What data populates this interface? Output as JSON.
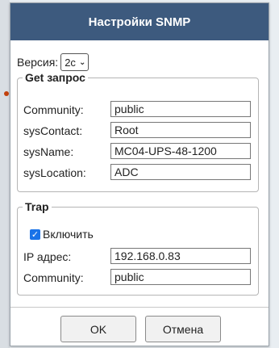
{
  "dialog": {
    "title": "Настройки SNMP",
    "version": {
      "label": "Версия:",
      "selected": "2c"
    },
    "get_section": {
      "legend": "Get запрос",
      "fields": [
        {
          "label": "Community:",
          "value": "public"
        },
        {
          "label": "sysContact:",
          "value": "Root"
        },
        {
          "label": "sysName:",
          "value": "MC04-UPS-48-1200"
        },
        {
          "label": "sysLocation:",
          "value": "ADC"
        }
      ]
    },
    "trap_section": {
      "legend": "Trap",
      "enable_label": "Включить",
      "enable_checked": true,
      "fields": [
        {
          "label": "IP адрес:",
          "value": "192.168.0.83"
        },
        {
          "label": "Community:",
          "value": "public"
        }
      ]
    },
    "buttons": {
      "ok": "OK",
      "cancel": "Отмена"
    }
  },
  "colors": {
    "titlebar": "#3d5a7e",
    "checkbox": "#1a73e8"
  }
}
